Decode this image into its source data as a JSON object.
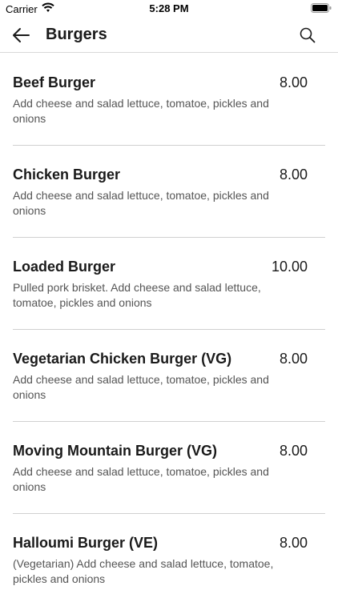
{
  "status_bar": {
    "carrier": "Carrier",
    "time": "5:28 PM"
  },
  "header": {
    "title": "Burgers"
  },
  "items": [
    {
      "name": "Beef Burger",
      "price": "8.00",
      "description": "Add cheese and salad lettuce, tomatoe, pickles and onions"
    },
    {
      "name": "Chicken Burger",
      "price": "8.00",
      "description": "Add cheese and salad lettuce, tomatoe, pickles and onions"
    },
    {
      "name": "Loaded Burger",
      "price": "10.00",
      "description": "Pulled pork brisket. Add cheese and salad lettuce, tomatoe, pickles and onions"
    },
    {
      "name": "Vegetarian Chicken Burger (VG)",
      "price": "8.00",
      "description": "Add cheese and salad lettuce, tomatoe, pickles and onions"
    },
    {
      "name": "Moving Mountain Burger (VG)",
      "price": "8.00",
      "description": "Add cheese and salad lettuce, tomatoe, pickles and onions"
    },
    {
      "name": "Halloumi Burger (VE)",
      "price": "8.00",
      "description": "(Vegetarian) Add cheese and salad lettuce, tomatoe, pickles and onions"
    }
  ]
}
